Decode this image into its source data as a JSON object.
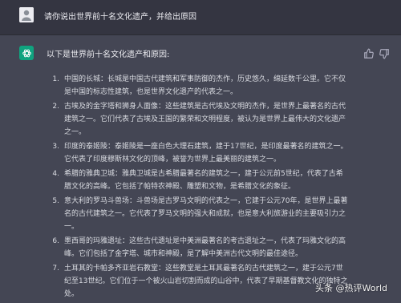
{
  "user_message": {
    "text": "请你说出世界前十名文化遗产，并给出原因"
  },
  "assistant_message": {
    "intro": "以下是世界前十名文化遗产和原因:",
    "items": [
      {
        "num": "1.",
        "lines": [
          "中国的长城：长城是中国古代建筑和军事防御的杰作，历史悠久，绵延数千公里。它不仅",
          "是中国的标志性建筑，也是世界文化遗产的代表之一。"
        ]
      },
      {
        "num": "2.",
        "lines": [
          "古埃及的金字塔和狮身人面像：这些建筑是古代埃及文明的杰作，是世界上最著名的古代",
          "建筑之一。它们代表了古埃及王国的繁荣和文明程度，被认为是世界上最伟大的文化遗产",
          "之一。"
        ]
      },
      {
        "num": "3.",
        "lines": [
          "印度的泰姬陵：泰姬陵是一座白色大理石建筑，建于17世纪，是印度最著名的建筑之一。",
          "它代表了印度穆斯林文化的顶峰，被誉为世界上最美丽的建筑之一。"
        ]
      },
      {
        "num": "4.",
        "lines": [
          "希腊的雅典卫城：雅典卫城是古希腊最著名的建筑之一，建于公元前5世纪，代表了古希",
          "腊文化的高峰。它包括了帕特农神殿、雕塑和文物，是希腊文化的象征。"
        ]
      },
      {
        "num": "5.",
        "lines": [
          "意大利的罗马斗兽场：斗兽场是古罗马文明的代表之一，它建于公元70年，是世界上最著",
          "名的古代建筑之一。它代表了罗马文明的强大和成就，也是意大利旅游业的主要吸引力之",
          "一。"
        ]
      },
      {
        "num": "6.",
        "lines": [
          "墨西哥的玛雅遗址：这些古代遗址是中美洲最著名的考古遗址之一，代表了玛雅文化的高",
          "峰。它们包括了金字塔、城市和神殿，是了解中美洲古代文明的最佳途径。"
        ]
      },
      {
        "num": "7.",
        "lines": [
          "土耳其的卡帕多齐亚岩石教堂：这些教堂是土耳其最著名的古代建筑之一，建于公元7世",
          "纪至13世纪。它们位于一个被火山岩切割而成的山谷中，代表了早期基督教文化的独特之",
          "处。"
        ]
      }
    ]
  },
  "watermark": {
    "text": "头条 @热评World"
  }
}
